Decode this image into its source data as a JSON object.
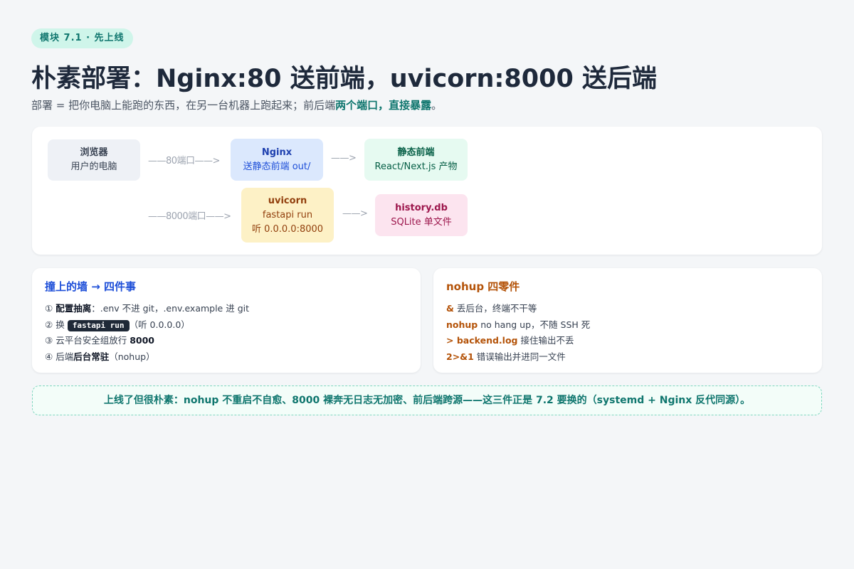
{
  "badge": "模块 7.1 · 先上线",
  "title": "朴素部署：Nginx:80 送前端，uvicorn:8000 送后端",
  "subtitle": {
    "lead": "部署 = 把你电脑上能跑的东西，在另一台机器上跑起来；前后端",
    "highlight": "两个端口，直接暴露",
    "tail": "。"
  },
  "diagram": {
    "browser": {
      "title": "浏览器",
      "sub": "用户的电脑"
    },
    "arrow_80": "——80端口——>",
    "nginx": {
      "title": "Nginx",
      "sub": "送静态前端 out/"
    },
    "arrow_nginx_static": "——>",
    "static": {
      "title": "静态前端",
      "sub": "React/Next.js 产物"
    },
    "arrow_8000": "——8000端口——>",
    "uvicorn": {
      "title": "uvicorn",
      "line1": "fastapi run",
      "line2": "听 0.0.0.0:8000"
    },
    "arrow_uvicorn_history": "——>",
    "history": {
      "title": "history.db",
      "sub": "SQLite 单文件"
    }
  },
  "walls": {
    "title": "撞上的墙 → 四件事",
    "items": [
      {
        "num": "①",
        "bold": "配置抽离",
        "rest": "：.env 不进 git，.env.example 进 git"
      },
      {
        "num": "②",
        "pre": "换",
        "code": "fastapi run",
        "post": "（听 0.0.0.0）"
      },
      {
        "num": "③",
        "pre": "云平台安全组放行",
        "bold": "8000"
      },
      {
        "num": "④",
        "pre": "后端",
        "bold": "后台常驻",
        "post": "（nohup）"
      }
    ]
  },
  "nohup": {
    "title": "nohup 四零件",
    "items": [
      {
        "kw": "&",
        "text": "丢后台，终端不干等"
      },
      {
        "kw": "nohup",
        "text": "no hang up，不随 SSH 死"
      },
      {
        "kw": "> backend.log",
        "text": "接住输出不丢"
      },
      {
        "kw": "2>&1",
        "text": "错误输出并进同一文件"
      }
    ]
  },
  "note": "上线了但很朴素：nohup 不重启不自愈、8000 裸奔无日志无加密、前后端跨源——这三件正是 7.2 要换的（systemd + Nginx 反代同源）。",
  "colors": {
    "accent_teal": "#0f766e",
    "blue": "#1d4ed8",
    "amber": "#b45309",
    "pink": "#9d174d"
  }
}
